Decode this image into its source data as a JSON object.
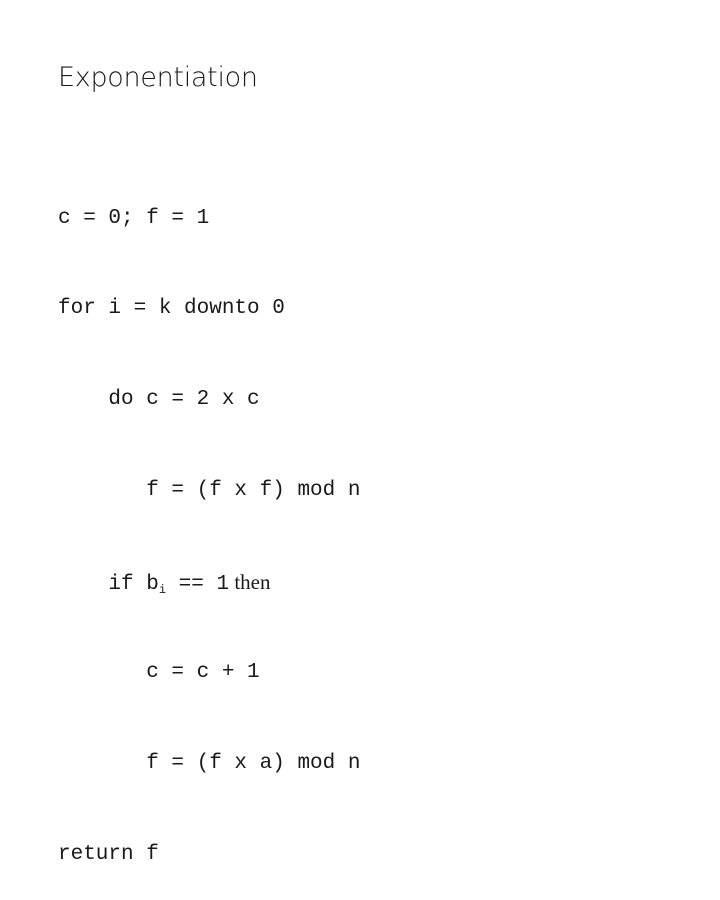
{
  "slide": {
    "title": "Exponentiation",
    "code_lines": [
      {
        "indent": "",
        "text": "c = 0; f = 1"
      },
      {
        "indent": "",
        "text": "for i = k downto 0"
      },
      {
        "indent": "    ",
        "text": "do c = 2 x c"
      },
      {
        "indent": "       ",
        "text": "f = (f x f) mod n"
      },
      {
        "indent": "    ",
        "text": "if b",
        "sub": "i",
        "rest": " == 1",
        "word": " then"
      },
      {
        "indent": "       ",
        "text": "c = c + 1"
      },
      {
        "indent": "       ",
        "text": "f = (f x a) mod n"
      },
      {
        "indent": "",
        "text": "return f"
      }
    ]
  }
}
